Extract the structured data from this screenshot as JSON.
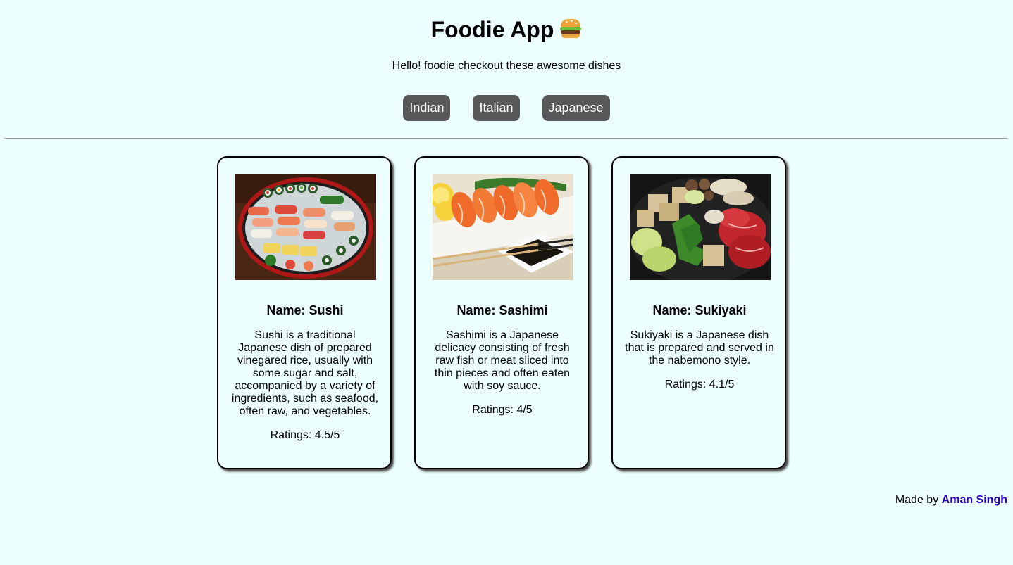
{
  "header": {
    "title": "Foodie App",
    "title_icon": "hamburger-emoji",
    "tagline": "Hello! foodie checkout these awesome dishes"
  },
  "nav": {
    "buttons": [
      "Indian",
      "Italian",
      "Japanese"
    ],
    "button_color": "#58585b"
  },
  "dishes": [
    {
      "name": "Name: Sushi",
      "description": "Sushi is a traditional Japanese dish of prepared vinegared rice, usually with some sugar and salt, accompanied by a variety of ingredients, such as seafood, often raw, and vegetables.",
      "rating": "Ratings: 4.5/5",
      "image": "sushi-platter-photo"
    },
    {
      "name": "Name: Sashimi",
      "description": "Sashimi is a Japanese delicacy consisting of fresh raw fish or meat sliced into thin pieces and often eaten with soy sauce.",
      "rating": "Ratings: 4/5",
      "image": "sashimi-salmon-photo"
    },
    {
      "name": "Name: Sukiyaki",
      "description": "Sukiyaki is a Japanese dish that is prepared and served in the nabemono style.",
      "rating": "Ratings: 4.1/5",
      "image": "sukiyaki-hotpot-photo"
    }
  ],
  "footer": {
    "prefix": "Made by",
    "author": "Aman Singh",
    "link_color": "#2a00cc"
  },
  "colors": {
    "background": "#ecfffe"
  }
}
